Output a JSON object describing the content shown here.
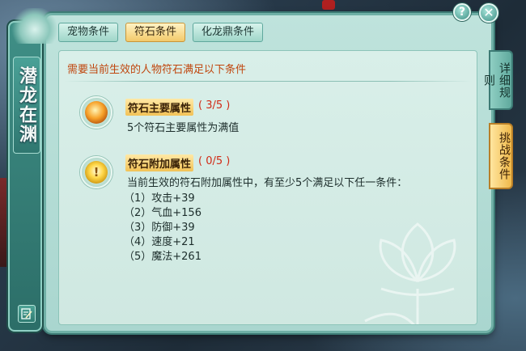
{
  "window": {
    "title": "潜龙在渊",
    "help_label": "?",
    "close_label": "✕"
  },
  "tabs": [
    {
      "label": "宠物条件",
      "active": false
    },
    {
      "label": "符石条件",
      "active": true
    },
    {
      "label": "化龙鼎条件",
      "active": false
    }
  ],
  "side_tabs": [
    {
      "label": "详细规则"
    },
    {
      "label": "挑战条件"
    }
  ],
  "content": {
    "headline": "需要当前生效的人物符石满足以下条件",
    "main_attr": {
      "title": "符石主要属性",
      "count": "( 3/5 )",
      "description": "5个符石主要属性为满值",
      "icon": "orange-gem-icon"
    },
    "extra_attr": {
      "title": "符石附加属性",
      "count": "( 0/5 )",
      "description": "当前生效的符石附加属性中，有至少5个满足以下任一条件：",
      "icon": "yellow-gem-icon",
      "conditions": [
        "（1）攻击+39",
        "（2）气血+156",
        "（3）防御+39",
        "（4）速度+21",
        "（5）魔法+261"
      ]
    }
  },
  "colors": {
    "accent_orange": "#c0460e",
    "count_red": "#d12a16",
    "active_tab": "#f3c96a",
    "panel": "#bfe3dc"
  }
}
